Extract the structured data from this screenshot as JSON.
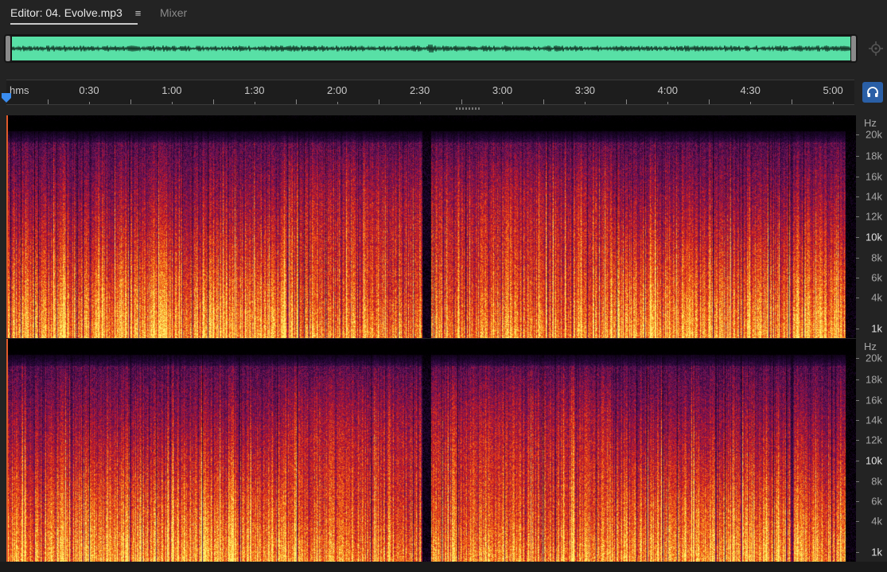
{
  "tabs": {
    "editor_label": "Editor: 04. Evolve.mp3",
    "menu_glyph": "≡",
    "mixer_label": "Mixer"
  },
  "ruler": {
    "unit": "hms",
    "labels": [
      "0:30",
      "1:00",
      "1:30",
      "2:00",
      "2:30",
      "3:00",
      "3:30",
      "4:00",
      "4:30",
      "5:00"
    ]
  },
  "hz_scale": {
    "unit": "Hz",
    "labels": [
      "20k",
      "18k",
      "16k",
      "14k",
      "12k",
      "10k",
      "8k",
      "6k",
      "4k",
      "1k"
    ]
  },
  "icons": {
    "zoom": "zoom-navigator-icon",
    "playhead": "playhead-marker-icon",
    "monitor": "headphones-icon"
  },
  "colors": {
    "overview_wave": "#58e0a6",
    "monitor_accent": "#2a5fa6",
    "playhead": "#3a8df0"
  }
}
